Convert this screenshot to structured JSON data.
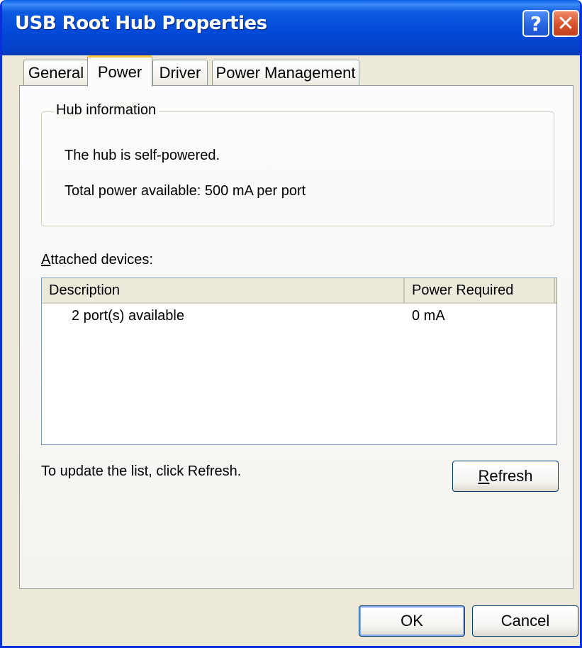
{
  "window": {
    "title": "USB Root Hub Properties",
    "help_glyph": "?",
    "close_glyph": "✕"
  },
  "tabs": [
    {
      "label": "General"
    },
    {
      "label": "Power"
    },
    {
      "label": "Driver"
    },
    {
      "label": "Power Management"
    }
  ],
  "hub_info": {
    "legend": "Hub information",
    "line1": "The hub is self-powered.",
    "line2": "Total power available:  500 mA per port"
  },
  "attached": {
    "label_accel": "A",
    "label_rest": "ttached devices:",
    "columns": [
      "Description",
      "Power Required"
    ],
    "rows": [
      {
        "description": "2 port(s) available",
        "power": "0 mA"
      }
    ]
  },
  "refresh": {
    "hint": "To update the list, click Refresh.",
    "button_accel": "R",
    "button_rest": "efresh"
  },
  "footer": {
    "ok": "OK",
    "cancel": "Cancel"
  },
  "colors": {
    "titlebar": "#0349d8",
    "dialog_bg": "#ece9d8",
    "tab_highlight": "#ffc83c",
    "close_button": "#d9512a"
  }
}
